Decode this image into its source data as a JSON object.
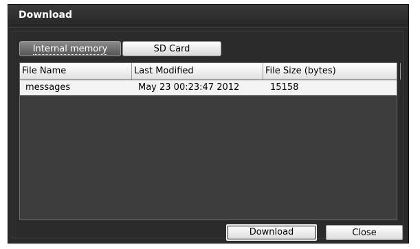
{
  "window": {
    "title": "Download"
  },
  "tabs": {
    "internal_label": "Internal memory",
    "sd_label": "SD Card"
  },
  "table": {
    "columns": [
      "File Name",
      "Last Modified",
      "File Size (bytes)"
    ],
    "rows": [
      {
        "name": "messages",
        "modified": "May 23 00:23:47 2012",
        "size": "15158"
      }
    ]
  },
  "buttons": {
    "download_label": "Download",
    "close_label": "Close"
  }
}
